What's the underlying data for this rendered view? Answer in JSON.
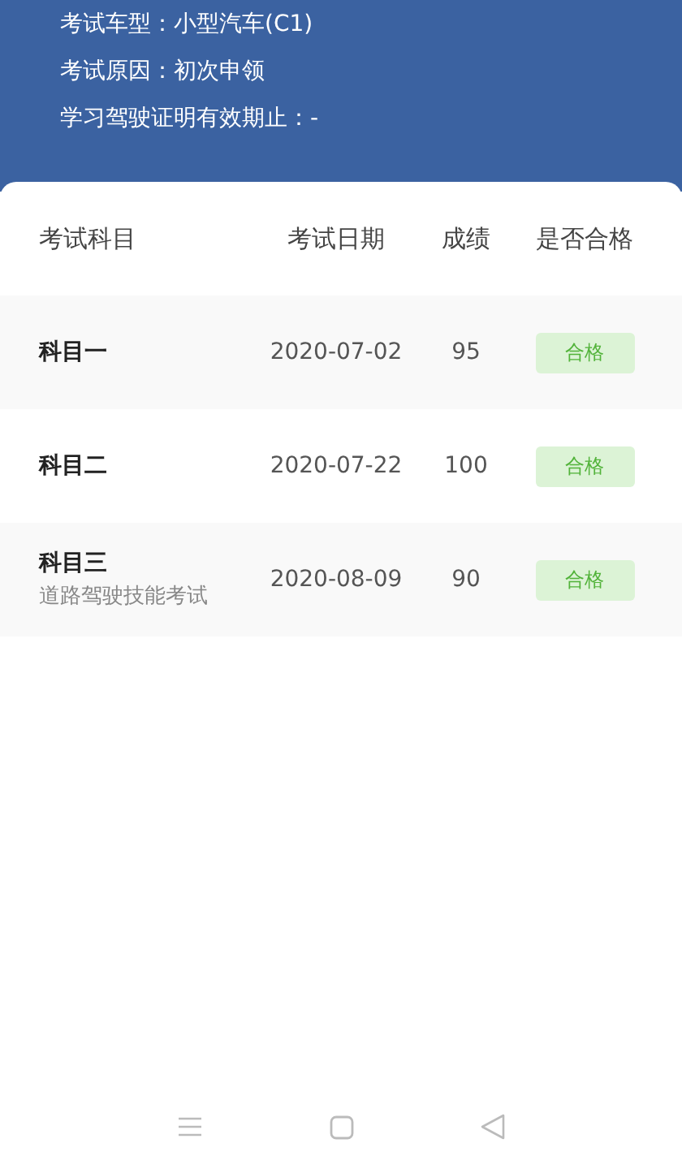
{
  "info": [
    "考试车型：小型汽车(C1)",
    "考试原因：初次申领",
    "学习驾驶证明有效期止：-"
  ],
  "table": {
    "columns": [
      "考试科目",
      "考试日期",
      "成绩",
      "是否合格"
    ],
    "rows": [
      {
        "subject": "科目一",
        "date": "2020-07-02",
        "score": "95",
        "result": "合格",
        "passed": true
      },
      {
        "subject": "科目二",
        "date": "2020-07-22",
        "score": "100",
        "result": "合格",
        "passed": true
      },
      {
        "subject": "科目三",
        "note": "道路驾驶技能考试",
        "date": "2020-08-09",
        "score": "90",
        "result": "合格",
        "passed": true
      }
    ]
  }
}
